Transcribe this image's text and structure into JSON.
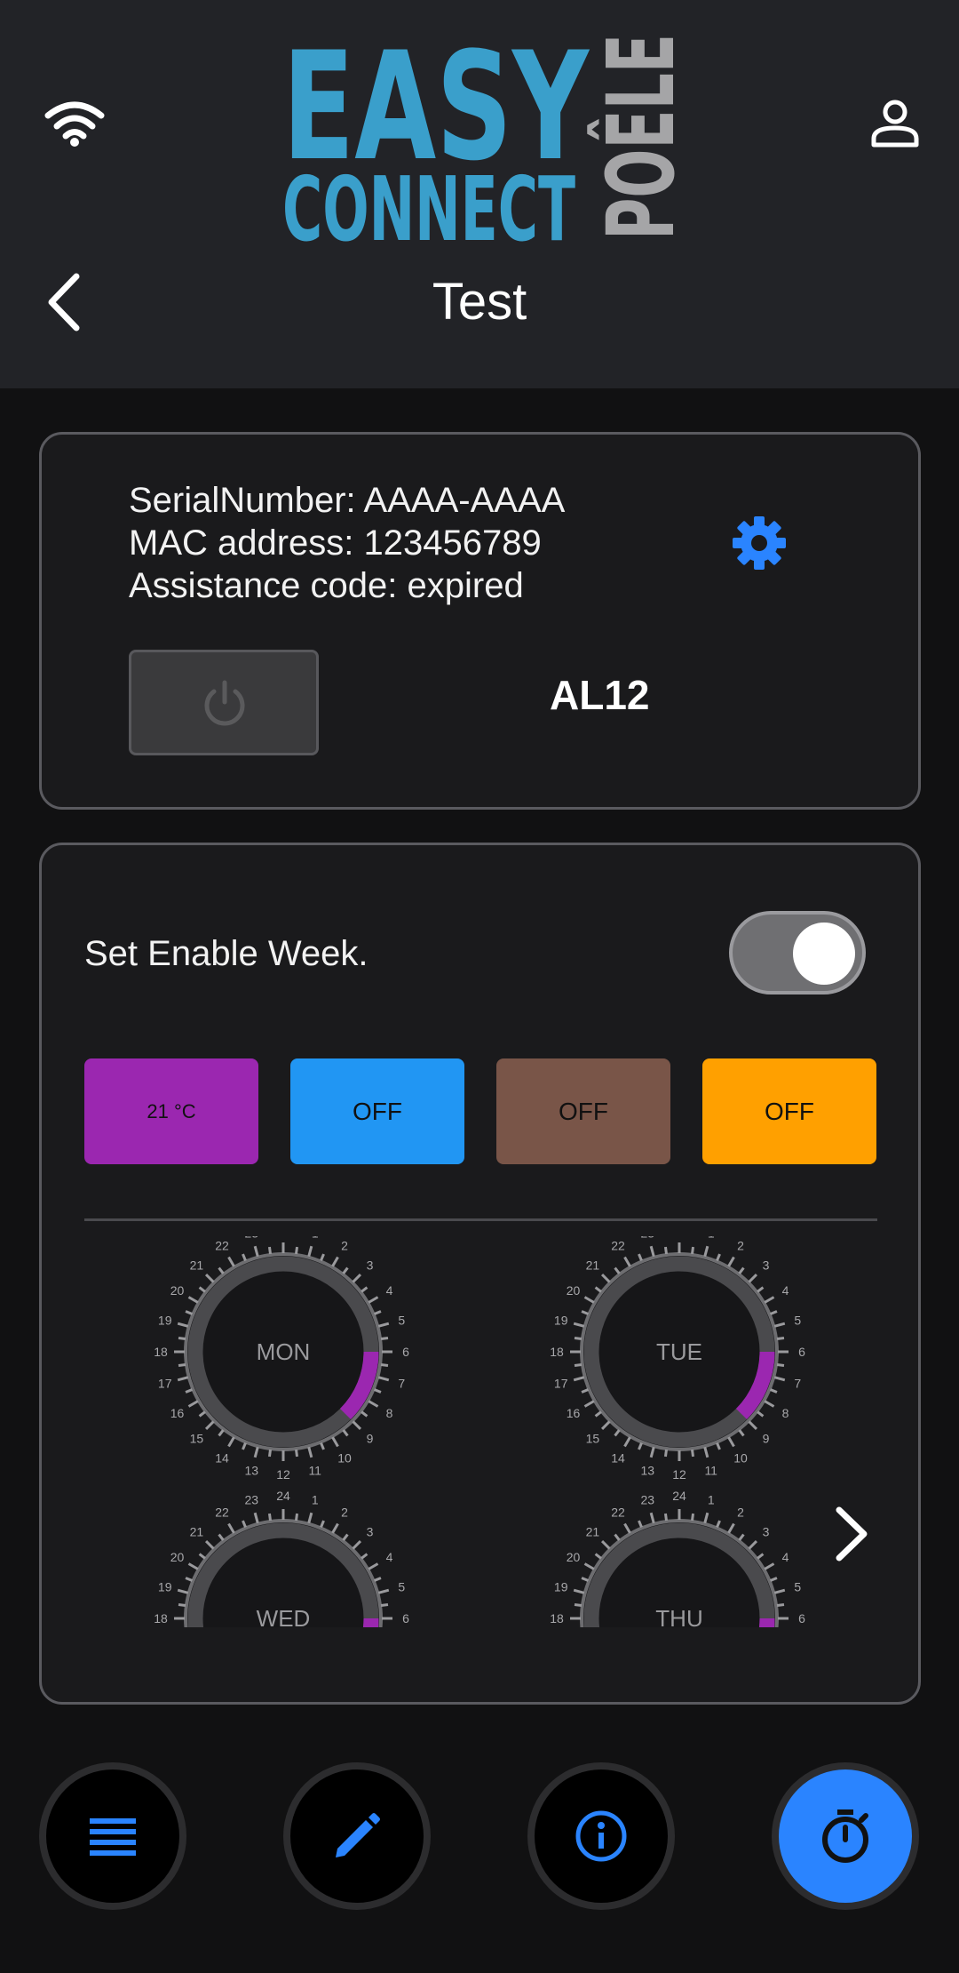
{
  "header": {
    "logo_text": {
      "line1": "EASY",
      "line2": "CONNECT",
      "vertical": "POÊLE"
    },
    "title": "Test"
  },
  "device": {
    "serial_line": "SerialNumber: AAAA-AAAA",
    "mac_line": "MAC address: 123456789",
    "assistance_line": "Assistance code: expired",
    "status_code": "AL12"
  },
  "week": {
    "label": "Set Enable Week.",
    "enabled": true,
    "chips": [
      {
        "label": "21 °C",
        "color": "#9b27b0"
      },
      {
        "label": "OFF",
        "color": "#2196f3"
      },
      {
        "label": "OFF",
        "color": "#795548"
      },
      {
        "label": "OFF",
        "color": "#ffa000"
      }
    ],
    "days": [
      "MON",
      "TUE",
      "WED",
      "THU"
    ],
    "hours": [
      "24",
      "1",
      "2",
      "3",
      "4",
      "5",
      "6",
      "7",
      "8",
      "9",
      "10",
      "11",
      "12",
      "13",
      "14",
      "15",
      "16",
      "17",
      "18",
      "19",
      "20",
      "21",
      "22",
      "23"
    ],
    "active_segment_hours": {
      "from": 6,
      "to": 9
    }
  },
  "colors": {
    "accent": "#2a84ff",
    "purple": "#9b27b0",
    "header_bg": "#222327"
  },
  "nav": {
    "items": [
      {
        "icon": "menu-icon"
      },
      {
        "icon": "pencil-icon"
      },
      {
        "icon": "info-icon"
      },
      {
        "icon": "timer-icon",
        "active": true
      }
    ]
  }
}
